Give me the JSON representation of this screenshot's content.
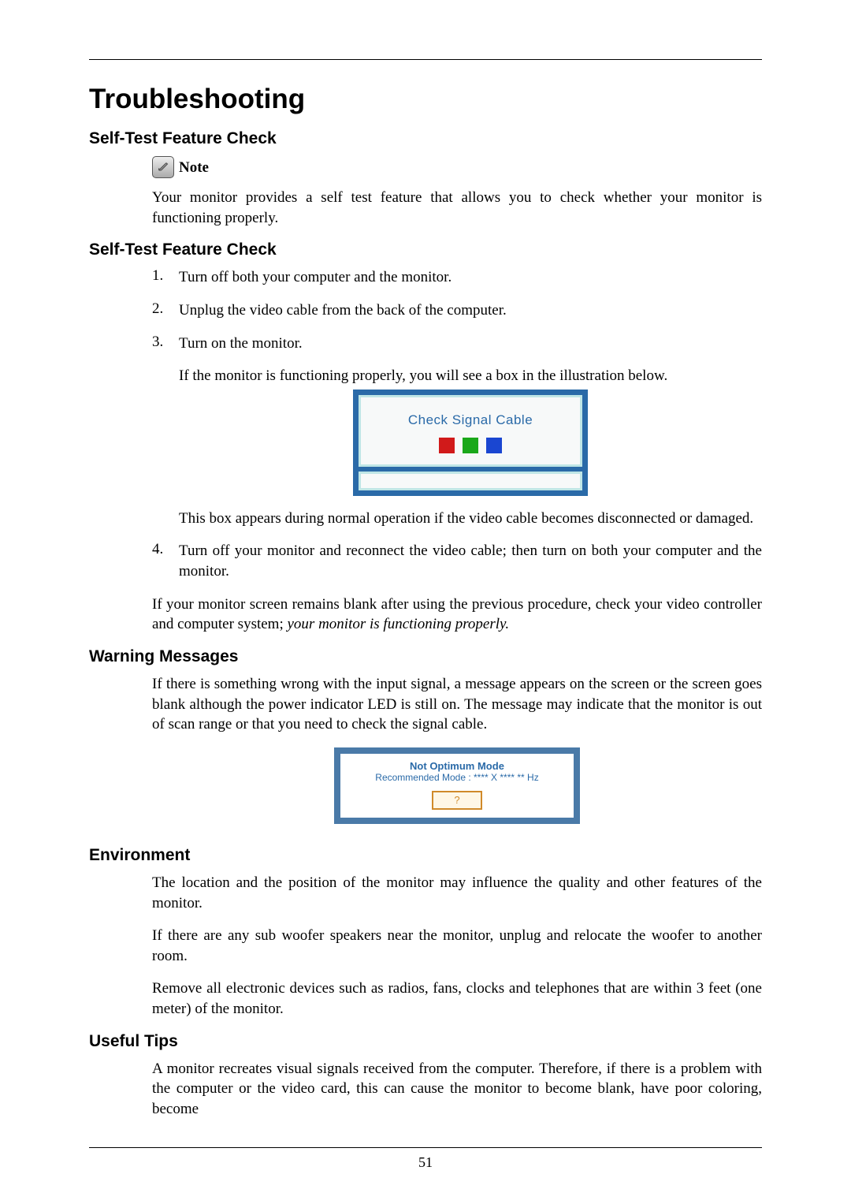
{
  "page_number": "51",
  "title": "Troubleshooting",
  "sec1": {
    "heading": "Self-Test Feature Check",
    "note_label": "Note",
    "note_text": "Your monitor provides a self test feature that allows you to check whether your monitor is functioning properly."
  },
  "sec2": {
    "heading": "Self-Test Feature Check",
    "steps": {
      "n1": "1.",
      "t1": "Turn off both your computer and the monitor.",
      "n2": "2.",
      "t2": "Unplug the video cable from the back of the computer.",
      "n3": "3.",
      "t3": "Turn on the monitor.",
      "t3b": "If the monitor is functioning properly, you will see a box in the illustration below.",
      "t3c": "This box appears during normal operation if the video cable becomes disconnected or damaged.",
      "n4": "4.",
      "t4": "Turn off your monitor and reconnect the video cable; then turn on both your computer and the monitor."
    },
    "closer_a": "If your monitor screen remains blank after using the previous procedure, check your video controller and computer system; ",
    "closer_b": "your monitor is functioning properly."
  },
  "fig1": {
    "text": "Check Signal Cable",
    "colors": {
      "red": "#d11a1a",
      "green": "#1aa81a",
      "blue": "#1a46d1"
    }
  },
  "sec3": {
    "heading": "Warning Messages",
    "text": "If there is something wrong with the input signal, a message appears on the screen or the screen goes blank although the power indicator LED is still on. The message may indicate that the monitor is out of scan range or that you need to check the signal cable."
  },
  "fig2": {
    "line1": "Not Optimum Mode",
    "line2": "Recommended Mode : **** X **** ** Hz",
    "button": "?"
  },
  "sec4": {
    "heading": "Environment",
    "p1": "The location and the position of the monitor may influence the quality and other features of the monitor.",
    "p2": "If there are any sub woofer speakers near the monitor, unplug and relocate the woofer to another room.",
    "p3": "Remove all electronic devices such as radios, fans, clocks and telephones that are within 3 feet (one meter) of the monitor."
  },
  "sec5": {
    "heading": "Useful Tips",
    "p1": "A monitor recreates visual signals received from the computer. Therefore, if there is a problem with the computer or the video card, this can cause the monitor to become blank, have poor coloring, become"
  }
}
